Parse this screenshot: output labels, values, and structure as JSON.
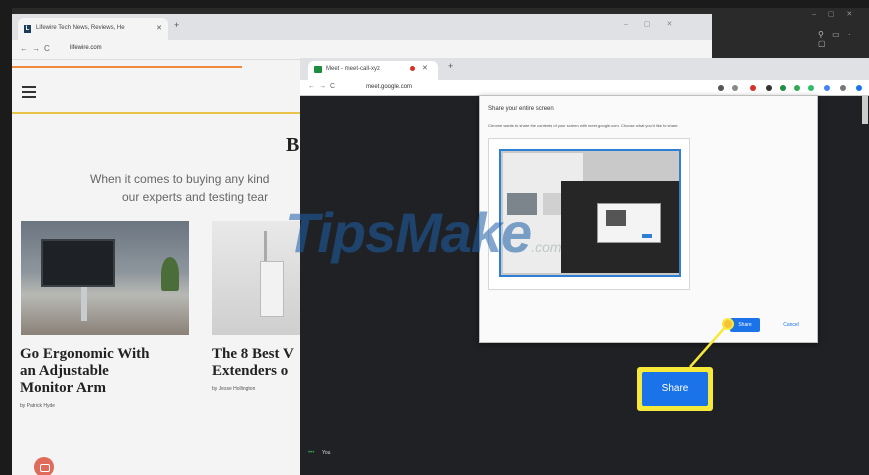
{
  "back_browser": {
    "tab_title": "Lifewire Tech News, Reviews, He",
    "tab_favicon": "L",
    "url": "lifewire.com",
    "headline_fragment": "B",
    "intro_line1": "When it comes to buying any kind",
    "intro_line2": "our experts and testing tear",
    "cards": [
      {
        "title_lines": [
          "Go Ergonomic With",
          "an Adjustable",
          "Monitor Arm"
        ],
        "byline": "by Patrick Hyde"
      },
      {
        "title_lines": [
          "The 8 Best V",
          "Extenders o"
        ],
        "byline": "by Jesse Hollington"
      }
    ]
  },
  "front_browser": {
    "tab_title": "Meet - meet-call-xyz",
    "url": "meet.google.com",
    "meet_label": "You"
  },
  "dialog": {
    "title": "Share your entire screen",
    "description": "Chrome wants to share the contents of your screen with meet.google.com. Choose what you'd like to share.",
    "share_label": "Share",
    "cancel_label": "Cancel"
  },
  "callout": {
    "share_label": "Share"
  },
  "watermark": {
    "text": "TipsMake",
    "suffix": ".com"
  },
  "colors": {
    "accent_blue": "#1a73e8",
    "highlight_yellow": "#f6e93a",
    "lifewire_orange": "#f08a3c"
  },
  "icons": [
    "menu-icon",
    "back-icon",
    "forward-icon",
    "refresh-icon",
    "lock-icon",
    "star-icon",
    "extension-icon",
    "chat-fab-icon"
  ]
}
